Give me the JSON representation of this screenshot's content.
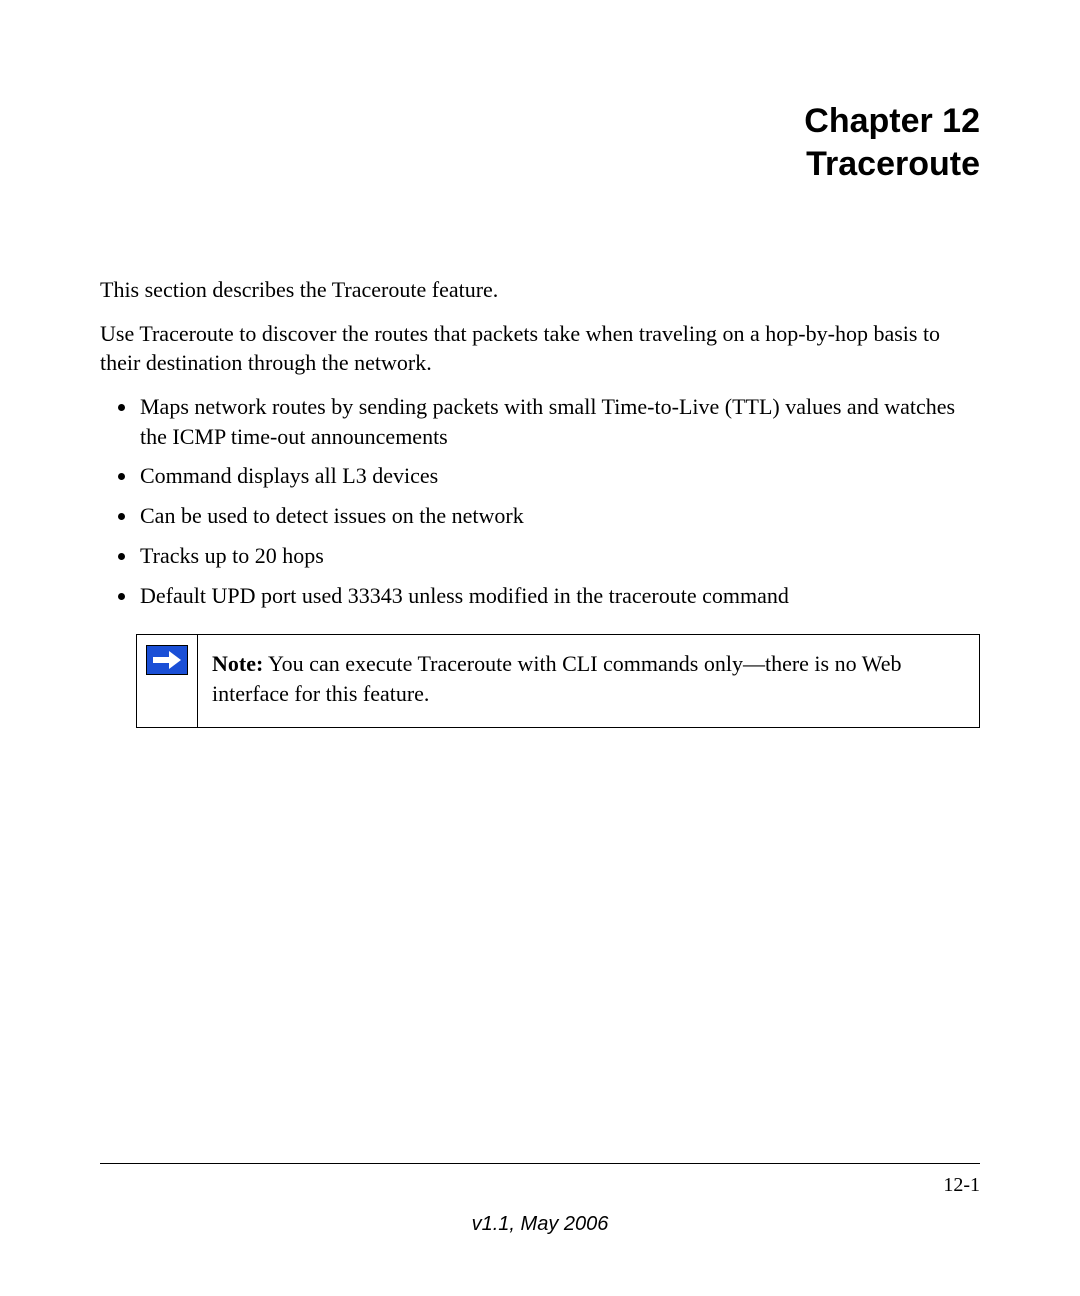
{
  "heading": {
    "line1": "Chapter 12",
    "line2": "Traceroute"
  },
  "paragraphs": {
    "p1": "This section describes the Traceroute feature.",
    "p2": "Use Traceroute to discover the routes that packets take when traveling on a hop-by-hop basis to their destination through the network."
  },
  "bullets": [
    "Maps network routes by sending packets with small Time-to-Live (TTL) values and watches the ICMP time-out announcements",
    "Command displays all L3 devices",
    "Can be used to detect issues on the network",
    "Tracks up to 20 hops",
    "Default UPD port used 33343 unless modified in the traceroute command"
  ],
  "note": {
    "label": "Note:",
    "text": " You can execute Traceroute with CLI commands only—there is no Web interface for this feature."
  },
  "footer": {
    "page": "12-1",
    "version": "v1.1, May 2006"
  }
}
